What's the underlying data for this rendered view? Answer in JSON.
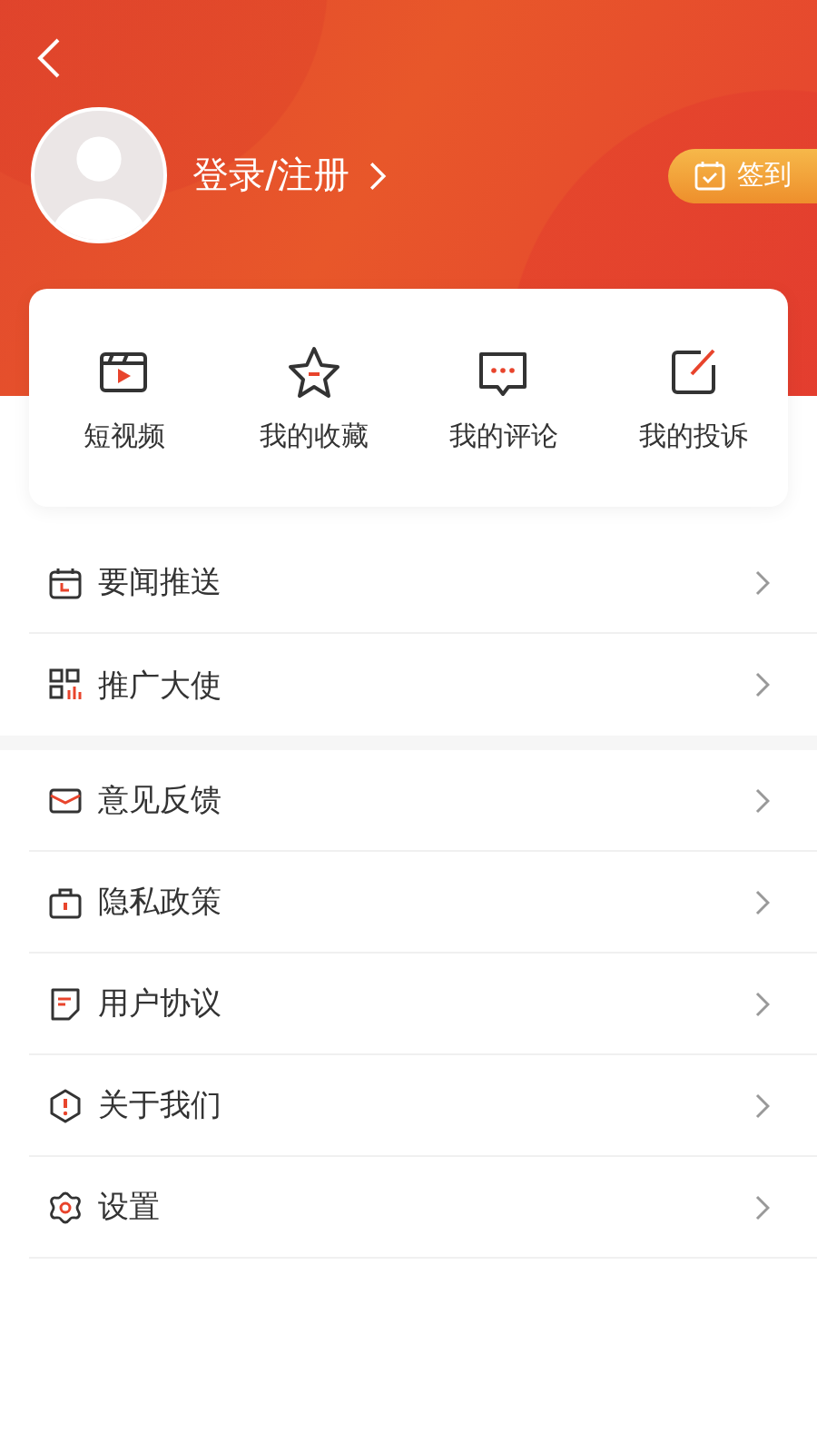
{
  "header": {
    "login_label": "登录/注册",
    "checkin_label": "签到"
  },
  "shortcuts": [
    {
      "label": "短视频"
    },
    {
      "label": "我的收藏"
    },
    {
      "label": "我的评论"
    },
    {
      "label": "我的投诉"
    }
  ],
  "menu_groups": [
    [
      {
        "label": "要闻推送"
      },
      {
        "label": "推广大使"
      }
    ],
    [
      {
        "label": "意见反馈"
      },
      {
        "label": "隐私政策"
      },
      {
        "label": "用户协议"
      },
      {
        "label": "关于我们"
      },
      {
        "label": "设置"
      }
    ]
  ]
}
